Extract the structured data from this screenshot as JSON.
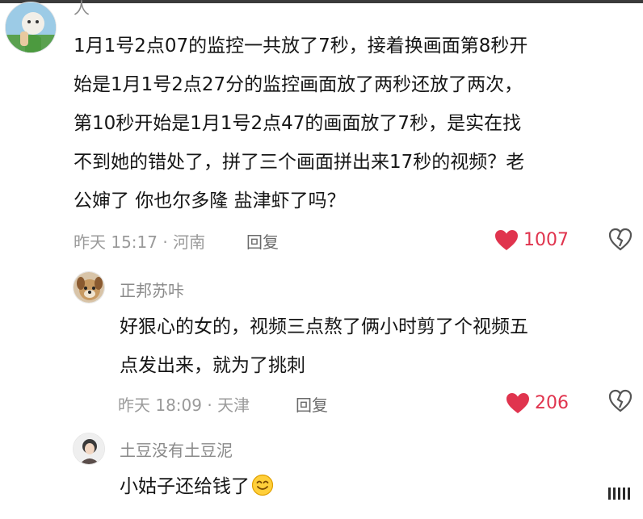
{
  "colors": {
    "like": "#e0344e",
    "meta": "#9a9a9a",
    "text": "#161616"
  },
  "comments": [
    {
      "user": "人",
      "lines": [
        "1月1号2点07的监控一共放了7秒，接着换画面第8秒开",
        "始是1月1号2点27分的监控画面放了两秒还放了两次，",
        "第10秒开始是1月1号2点47的画面放了7秒，是实在找",
        "不到她的错处了，拼了三个画面拼出来17秒的视频？老",
        "公婶了 你也尔多隆 盐津虾了吗？"
      ],
      "time_location": "昨天 15:17 · 河南",
      "reply_label": "回复",
      "likes": "1007"
    },
    {
      "user": "正邦苏咔",
      "lines": [
        "好狠心的女的，视频三点熬了俩小时剪了个视频五",
        "点发出来，就为了挑刺"
      ],
      "time_location": "昨天 18:09 · 天津",
      "reply_label": "回复",
      "likes": "206"
    },
    {
      "user": "土豆没有土豆泥",
      "lines": [
        "小姑子还给钱了"
      ],
      "emoji": "smiling-face-emoji"
    }
  ]
}
